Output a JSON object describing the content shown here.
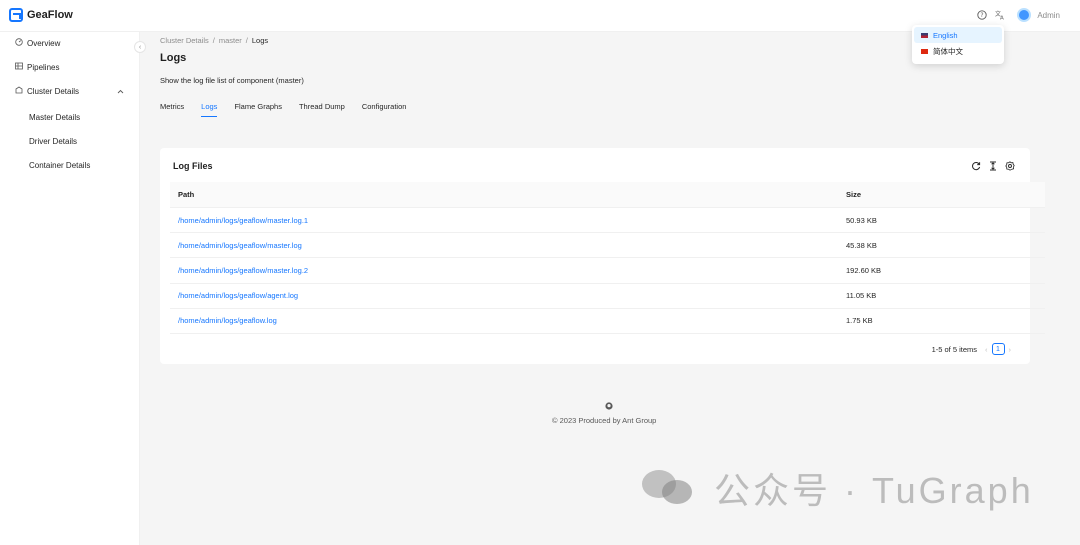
{
  "app": {
    "name": "GeaFlow"
  },
  "header": {
    "user": "Admin",
    "help_icon": "help-circle-icon",
    "translate_icon": "translate-icon"
  },
  "sidebar": {
    "items": [
      {
        "label": "Overview",
        "icon": "dashboard-icon"
      },
      {
        "label": "Pipelines",
        "icon": "table-icon"
      },
      {
        "label": "Cluster Details",
        "icon": "cluster-icon"
      }
    ],
    "sub_items": [
      {
        "label": "Master Details"
      },
      {
        "label": "Driver Details"
      },
      {
        "label": "Container Details"
      }
    ]
  },
  "breadcrumb": [
    "Cluster Details",
    "/",
    "master",
    "/",
    "Logs"
  ],
  "page": {
    "title": "Logs",
    "description": "Show the log file list of component (master)"
  },
  "tabs": [
    {
      "label": "Metrics",
      "active": false
    },
    {
      "label": "Logs",
      "active": true
    },
    {
      "label": "Flame Graphs",
      "active": false
    },
    {
      "label": "Thread Dump",
      "active": false
    },
    {
      "label": "Configuration",
      "active": false
    }
  ],
  "log_files": {
    "title": "Log Files",
    "columns": [
      "Path",
      "Size"
    ],
    "rows": [
      {
        "path": "/home/admin/logs/geaflow/master.log.1",
        "size": "50.93 KB"
      },
      {
        "path": "/home/admin/logs/geaflow/master.log",
        "size": "45.38 KB"
      },
      {
        "path": "/home/admin/logs/geaflow/master.log.2",
        "size": "192.60 KB"
      },
      {
        "path": "/home/admin/logs/geaflow/agent.log",
        "size": "11.05 KB"
      },
      {
        "path": "/home/admin/logs/geaflow.log",
        "size": "1.75 KB"
      }
    ],
    "pagination": {
      "summary": "1-5 of 5 items",
      "current_page": "1"
    }
  },
  "footer": {
    "text": "© 2023 Produced by Ant Group"
  },
  "language_menu": {
    "options": [
      {
        "label": "English",
        "selected": true
      },
      {
        "label": "简体中文",
        "selected": false
      }
    ]
  },
  "watermark": {
    "text": "公众号 · TuGraph"
  },
  "colors": {
    "accent": "#1677ff",
    "background": "#f5f5f5"
  }
}
